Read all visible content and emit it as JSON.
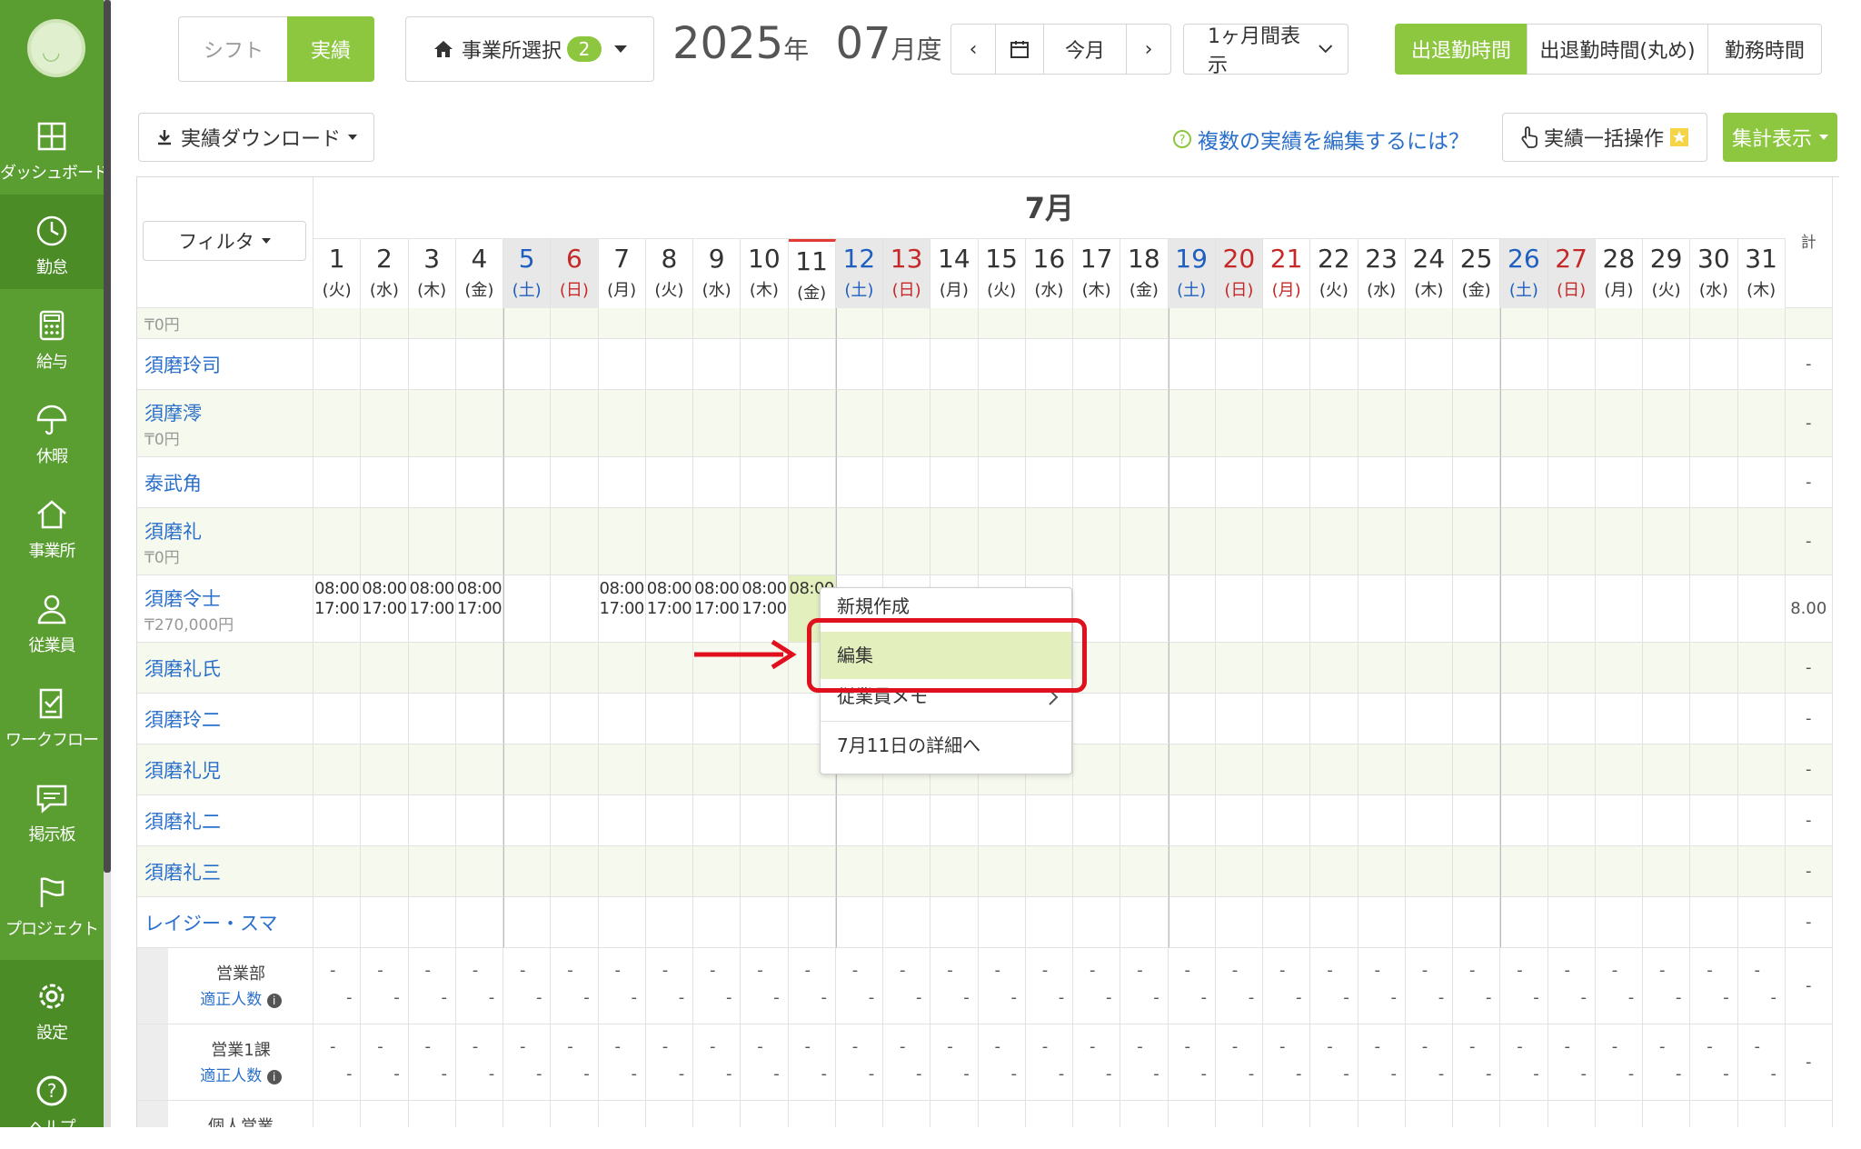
{
  "sidebar": {
    "items": [
      {
        "id": "dashboard",
        "label": "ダッシュボード",
        "icon": "grid-icon"
      },
      {
        "id": "attendance",
        "label": "勤怠",
        "icon": "clock-icon",
        "active": true
      },
      {
        "id": "payroll",
        "label": "給与",
        "icon": "calculator-icon"
      },
      {
        "id": "vacation",
        "label": "休暇",
        "icon": "umbrella-icon"
      },
      {
        "id": "office",
        "label": "事業所",
        "icon": "home-icon"
      },
      {
        "id": "employees",
        "label": "従業員",
        "icon": "person-icon"
      },
      {
        "id": "workflow",
        "label": "ワークフロー",
        "icon": "checklist-icon"
      },
      {
        "id": "board",
        "label": "掲示板",
        "icon": "chat-icon"
      },
      {
        "id": "project",
        "label": "プロジェクト",
        "icon": "flag-icon"
      }
    ],
    "settings": {
      "label": "設定",
      "icon": "gear-icon"
    },
    "help": {
      "label": "ヘルプ",
      "icon": "help-icon"
    }
  },
  "toolbar": {
    "mode_shift": "シフト",
    "mode_actual": "実績",
    "office_select": "事業所選択",
    "office_count": "2",
    "year": "2025",
    "year_unit": "年",
    "month": "07",
    "month_unit": "月度",
    "prev": "‹",
    "today": "今月",
    "next": "›",
    "range": "1ヶ月間表示",
    "view_tabs": [
      "出退勤時間",
      "出退勤時間(丸め)",
      "勤務時間"
    ],
    "download": "実績ダウンロード",
    "help_link": "複数の実績を編集するには？",
    "bulk": "実績一括操作",
    "summary": "集計表示"
  },
  "table": {
    "month_label": "7月",
    "filter": "フィルタ",
    "total_label": "計",
    "days": [
      {
        "d": "1",
        "w": "(火)",
        "t": ""
      },
      {
        "d": "2",
        "w": "(水)",
        "t": ""
      },
      {
        "d": "3",
        "w": "(木)",
        "t": ""
      },
      {
        "d": "4",
        "w": "(金)",
        "t": ""
      },
      {
        "d": "5",
        "w": "(土)",
        "t": "sat"
      },
      {
        "d": "6",
        "w": "(日)",
        "t": "sun"
      },
      {
        "d": "7",
        "w": "(月)",
        "t": ""
      },
      {
        "d": "8",
        "w": "(火)",
        "t": ""
      },
      {
        "d": "9",
        "w": "(水)",
        "t": ""
      },
      {
        "d": "10",
        "w": "(木)",
        "t": ""
      },
      {
        "d": "11",
        "w": "(金)",
        "t": "today"
      },
      {
        "d": "12",
        "w": "(土)",
        "t": "sat"
      },
      {
        "d": "13",
        "w": "(日)",
        "t": "sun"
      },
      {
        "d": "14",
        "w": "(月)",
        "t": ""
      },
      {
        "d": "15",
        "w": "(火)",
        "t": ""
      },
      {
        "d": "16",
        "w": "(水)",
        "t": ""
      },
      {
        "d": "17",
        "w": "(木)",
        "t": ""
      },
      {
        "d": "18",
        "w": "(金)",
        "t": ""
      },
      {
        "d": "19",
        "w": "(土)",
        "t": "sat"
      },
      {
        "d": "20",
        "w": "(日)",
        "t": "sun"
      },
      {
        "d": "21",
        "w": "(月)",
        "t": "hol"
      },
      {
        "d": "22",
        "w": "(火)",
        "t": ""
      },
      {
        "d": "23",
        "w": "(水)",
        "t": ""
      },
      {
        "d": "24",
        "w": "(木)",
        "t": ""
      },
      {
        "d": "25",
        "w": "(金)",
        "t": ""
      },
      {
        "d": "26",
        "w": "(土)",
        "t": "sat"
      },
      {
        "d": "27",
        "w": "(日)",
        "t": "sun"
      },
      {
        "d": "28",
        "w": "(月)",
        "t": ""
      },
      {
        "d": "29",
        "w": "(火)",
        "t": ""
      },
      {
        "d": "30",
        "w": "(水)",
        "t": ""
      },
      {
        "d": "31",
        "w": "(木)",
        "t": ""
      }
    ],
    "rows": [
      {
        "name": "",
        "wage": "₸0円",
        "total": "",
        "partial": true
      },
      {
        "name": "須磨玲司",
        "wage": "",
        "total": "-"
      },
      {
        "name": "須摩澪",
        "wage": "₸0円",
        "total": "-"
      },
      {
        "name": "泰武角",
        "wage": "",
        "total": "-"
      },
      {
        "name": "須磨礼",
        "wage": "₸0円",
        "total": "-"
      },
      {
        "name": "須磨令士",
        "wage": "₸270,000円",
        "total": "8.00",
        "shifts": [
          {
            "day": 1,
            "in": "08:00",
            "out": "17:00"
          },
          {
            "day": 2,
            "in": "08:00",
            "out": "17:00"
          },
          {
            "day": 3,
            "in": "08:00",
            "out": "17:00"
          },
          {
            "day": 4,
            "in": "08:00",
            "out": "17:00"
          },
          {
            "day": 7,
            "in": "08:00",
            "out": "17:00"
          },
          {
            "day": 8,
            "in": "08:00",
            "out": "17:00"
          },
          {
            "day": 9,
            "in": "08:00",
            "out": "17:00"
          },
          {
            "day": 10,
            "in": "08:00",
            "out": "17:00"
          },
          {
            "day": 11,
            "in": "08:00",
            "out": ""
          }
        ]
      },
      {
        "name": "須磨礼氏",
        "wage": "",
        "total": "-"
      },
      {
        "name": "須磨玲二",
        "wage": "",
        "total": "-"
      },
      {
        "name": "須磨礼児",
        "wage": "",
        "total": "-"
      },
      {
        "name": "須磨礼二",
        "wage": "",
        "total": "-"
      },
      {
        "name": "須磨礼三",
        "wage": "",
        "total": "-"
      },
      {
        "name": "レイジー・スマ",
        "wage": "",
        "total": "-"
      }
    ],
    "groups": [
      {
        "name": "営業部",
        "sub": "適正人数"
      },
      {
        "name": "営業1課",
        "sub": "適正人数"
      },
      {
        "name": "個人営業",
        "sub": ""
      }
    ],
    "dash": "-"
  },
  "context_menu": {
    "items": [
      "新規作成",
      "編集",
      "従業員メモ",
      "7月11日の詳細へ"
    ],
    "selected_index": 1
  },
  "colors": {
    "sidebar": "#5a9e31",
    "accent": "#8dc63f",
    "highlight": "#e0101e",
    "link": "#2a6fc9"
  }
}
